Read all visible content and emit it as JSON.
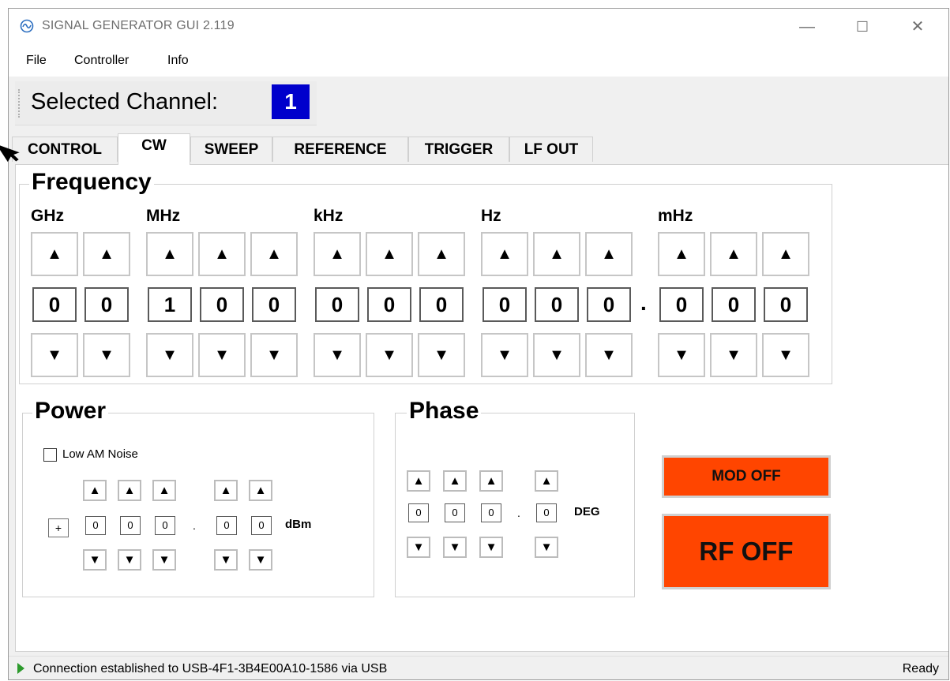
{
  "window": {
    "title": "SIGNAL GENERATOR GUI 2.119",
    "minimize_glyph": "—",
    "maximize_glyph": "☐",
    "close_glyph": "✕"
  },
  "menu": {
    "items": [
      "File",
      "Controller",
      "Info"
    ]
  },
  "channel": {
    "label": "Selected Channel:",
    "value": "1"
  },
  "tabs": [
    "CONTROL",
    "CW",
    "SWEEP",
    "REFERENCE",
    "TRIGGER",
    "LF OUT"
  ],
  "active_tab": "CW",
  "frequency": {
    "title": "Frequency",
    "up_glyph": "▲",
    "down_glyph": "▼",
    "units": [
      "GHz",
      "MHz",
      "kHz",
      "Hz",
      "mHz"
    ],
    "digits": [
      "0",
      "0",
      "1",
      "0",
      "0",
      "0",
      "0",
      "0",
      "0",
      "0",
      "0",
      "0",
      "0",
      "0"
    ],
    "decimal": "."
  },
  "power": {
    "title": "Power",
    "low_am_noise_label": "Low AM Noise",
    "low_am_noise_checked": false,
    "sign": "+",
    "digits": [
      "0",
      "0",
      "0",
      "0",
      "0"
    ],
    "decimal": ".",
    "unit": "dBm"
  },
  "phase": {
    "title": "Phase",
    "digits": [
      "0",
      "0",
      "0",
      "0"
    ],
    "decimal": ".",
    "unit": "DEG"
  },
  "buttons": {
    "mod": "MOD OFF",
    "rf": "RF OFF"
  },
  "colors": {
    "channel_bg": "#0000cc",
    "rf_button": "#ff4500",
    "status_arrow": "#2c9a2c"
  },
  "status": {
    "message": "Connection established to USB-4F1-3B4E00A10-1586 via USB",
    "state": "Ready"
  }
}
